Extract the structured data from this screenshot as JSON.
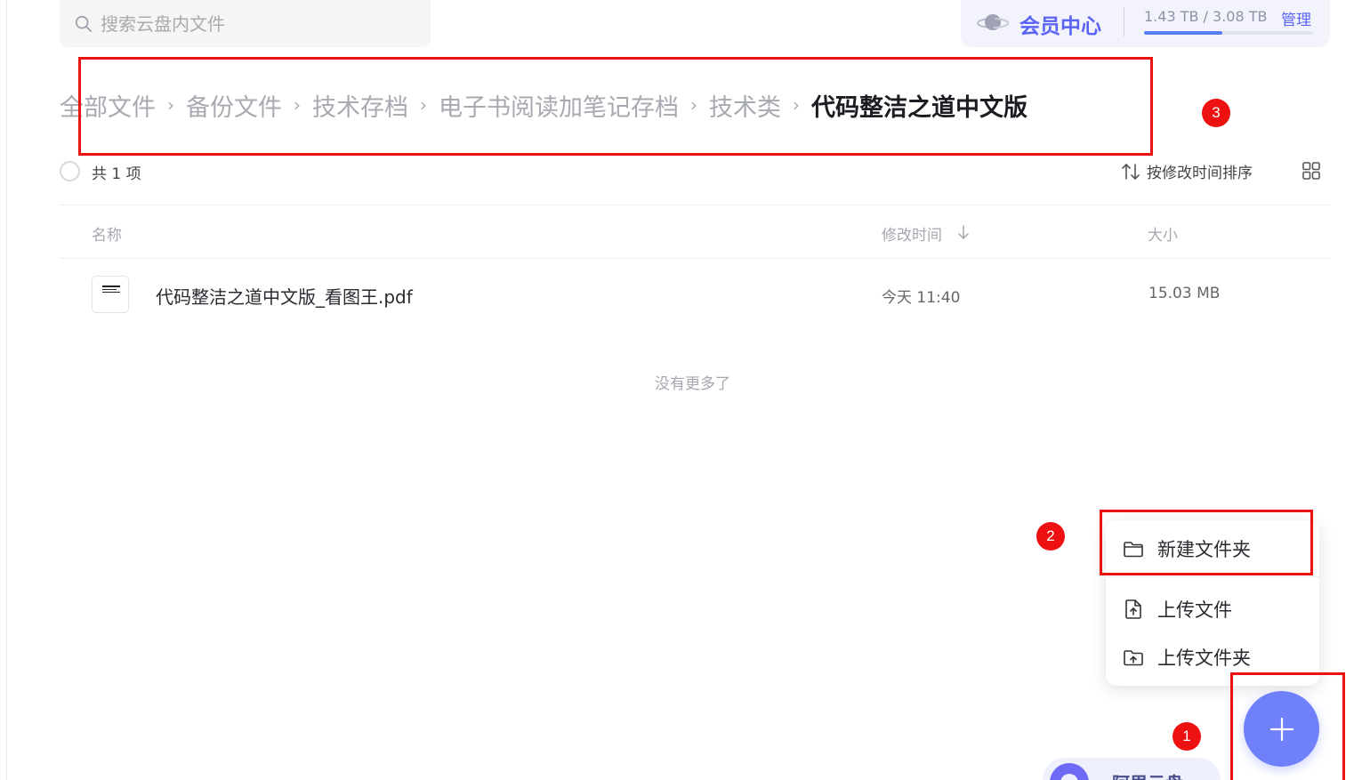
{
  "search": {
    "placeholder": "搜索云盘内文件"
  },
  "member": {
    "label": "会员中心",
    "quota_text": "1.43 TB / 3.08 TB",
    "quota_used_fraction": 0.464,
    "manage_label": "管理",
    "accent_color": "#5b64f5"
  },
  "breadcrumb": {
    "items": [
      "全部文件",
      "备份文件",
      "技术存档",
      "电子书阅读加笔记存档",
      "技术类"
    ],
    "current": "代码整洁之道中文版",
    "separator": "›"
  },
  "toolbar": {
    "count_label": "共 1 项",
    "sort_label": "按修改时间排序"
  },
  "table": {
    "columns": {
      "name": "名称",
      "modified": "修改时间",
      "size": "大小"
    },
    "rows": [
      {
        "name": "代码整洁之道中文版_看图王.pdf",
        "modified": "今天 11:40",
        "size": "15.03 MB"
      }
    ],
    "footer": "没有更多了"
  },
  "menu": {
    "items": [
      {
        "label": "新建文件夹",
        "icon": "folder-icon"
      },
      {
        "label": "上传文件",
        "icon": "upload-file-icon"
      },
      {
        "label": "上传文件夹",
        "icon": "upload-folder-icon"
      }
    ]
  },
  "fab": {
    "icon": "plus-icon",
    "color": "#6f80fa"
  },
  "bottom_pill": {
    "label": "阿里云盘"
  },
  "annotations": {
    "labels": [
      "1",
      "2",
      "3"
    ],
    "color": "#ee1111"
  }
}
